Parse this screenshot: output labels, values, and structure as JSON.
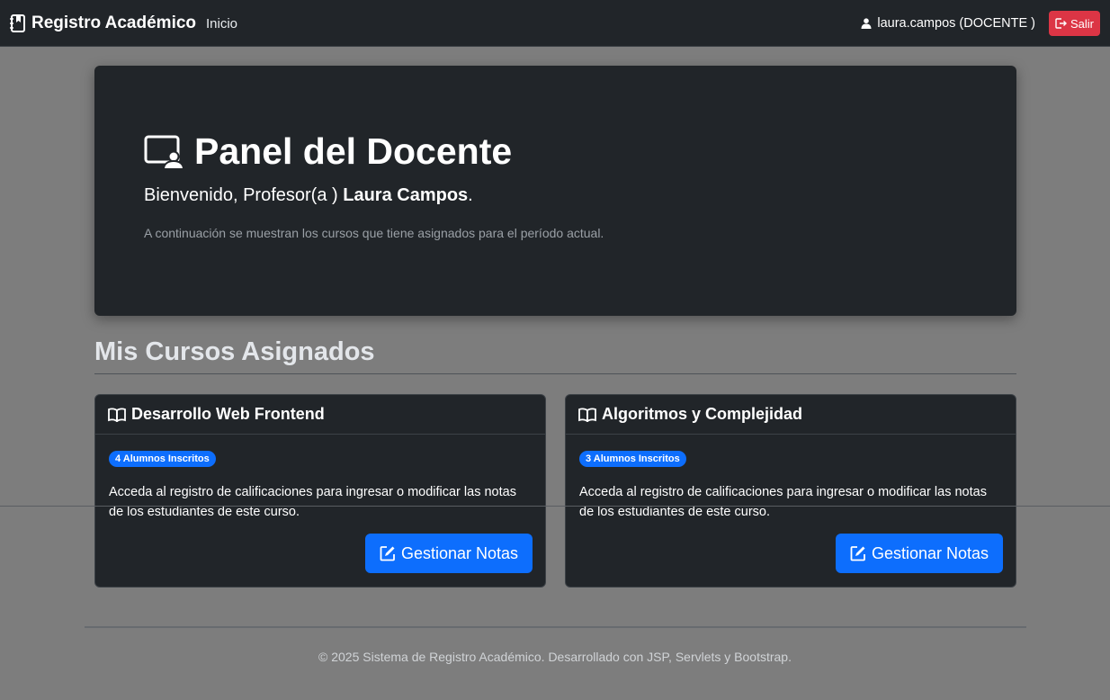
{
  "navbar": {
    "brand": "Registro Académico",
    "brand_icon": "journal-bookmark-icon",
    "inicio": "Inicio",
    "user": "laura.campos (DOCENTE )",
    "user_icon": "person-icon",
    "logout": "Salir",
    "logout_icon": "box-arrow-right-icon"
  },
  "hero": {
    "title": "Panel del Docente",
    "title_icon": "person-video-icon",
    "welcome_prefix": "Bienvenido, Profesor(a )",
    "welcome_name": "Laura Campos",
    "welcome_suffix": ".",
    "subtitle": "A continuación se muestran los cursos que tiene asignados para el período actual."
  },
  "section": {
    "title": "Mis Cursos Asignados"
  },
  "courses": [
    {
      "name": "Desarrollo Web Frontend",
      "badge": "4 Alumnos Inscritos",
      "description": "Acceda al registro de calificaciones para ingresar o modificar las notas de los estudiantes de este curso.",
      "button": "Gestionar Notas"
    },
    {
      "name": "Algoritmos y Complejidad",
      "badge": "3 Alumnos Inscritos",
      "description": "Acceda al registro de calificaciones para ingresar o modificar las notas de los estudiantes de este curso.",
      "button": "Gestionar Notas"
    }
  ],
  "footer": {
    "text": "© 2025 Sistema de Registro Académico. Desarrollado con JSP, Servlets y Bootstrap."
  },
  "colors": {
    "primary": "#0d6efd",
    "danger": "#dc3545",
    "dark": "#212529",
    "backdrop": "#7d7d7d"
  }
}
